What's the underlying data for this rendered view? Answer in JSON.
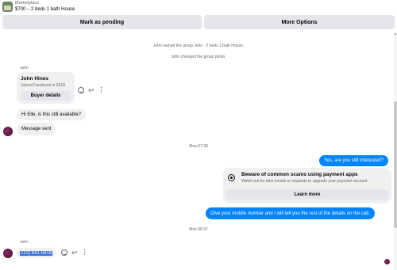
{
  "header": {
    "marketplace_label": "Marketplace",
    "listing_title": "$700 – 2 beds 1 bath House"
  },
  "actions": {
    "mark_pending": "Mark as pending",
    "more_options": "More Options"
  },
  "system_messages": [
    "John named the group John · 2 beds 1 bath House.",
    "John changed the group photo."
  ],
  "messages": {
    "sender_name_1": "John",
    "card": {
      "name": "John Hines",
      "subtitle": "Joined Facebook in 2018",
      "button": "Buyer details"
    },
    "msg1": "Hi Elle, is this still available?",
    "msg2": "Message sent",
    "time1": "Mon 07:28",
    "out1": "Yes, are you still interested?",
    "scam": {
      "title": "Beware of common scams using payment apps",
      "subtitle": "Watch out for fake emails or requests to upgrade your payment account.",
      "button": "Learn more"
    },
    "out2": "Give your mobile number and I will tell you the rest of the details on the call.",
    "time2": "Mon 08:37",
    "sender_name_2": "John",
    "phone": "213) 841-5918"
  },
  "icons": {
    "emoji": "emoji-icon",
    "reply": "reply-icon",
    "more": "more-vertical-icon",
    "shield": "shield-icon"
  },
  "colors": {
    "outgoing_bubble": "#0084ff",
    "incoming_bubble": "#f0f0f0",
    "button_bg": "#e4e6eb",
    "selection": "#3a6fd8"
  }
}
